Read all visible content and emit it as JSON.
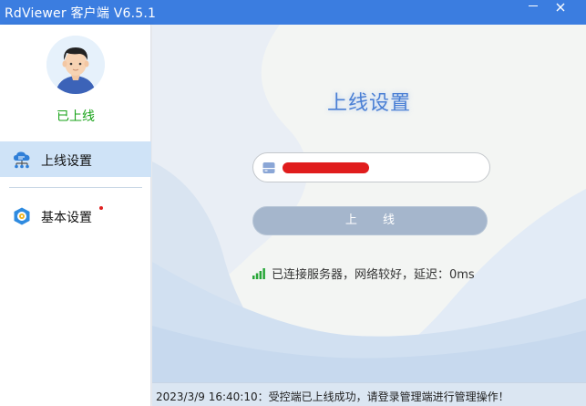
{
  "window": {
    "title": "RdViewer  客户端 V6.5.1"
  },
  "sidebar": {
    "user_status": "已上线",
    "items": [
      {
        "label": "上线设置",
        "icon": "cloud-network-icon",
        "active": true
      },
      {
        "label": "基本设置",
        "icon": "settings-badge-icon",
        "has_notification_dot": true
      }
    ]
  },
  "main": {
    "heading": "上线设置",
    "input": {
      "value_redacted": true,
      "icon": "server-icon"
    },
    "online_button_label": "上 线",
    "connection_status": "已连接服务器，网络较好，延迟：0ms"
  },
  "statusbar": {
    "message": "2023/3/9 16:40:10：受控端已上线成功，请登录管理端进行管理操作！"
  },
  "colors": {
    "titlebar": "#3b7de0",
    "active_nav": "#cfe3f7",
    "online_status": "#19a319",
    "heading": "#4a7fd4",
    "button": "#a5b6cc",
    "redaction": "#e01c1c"
  }
}
